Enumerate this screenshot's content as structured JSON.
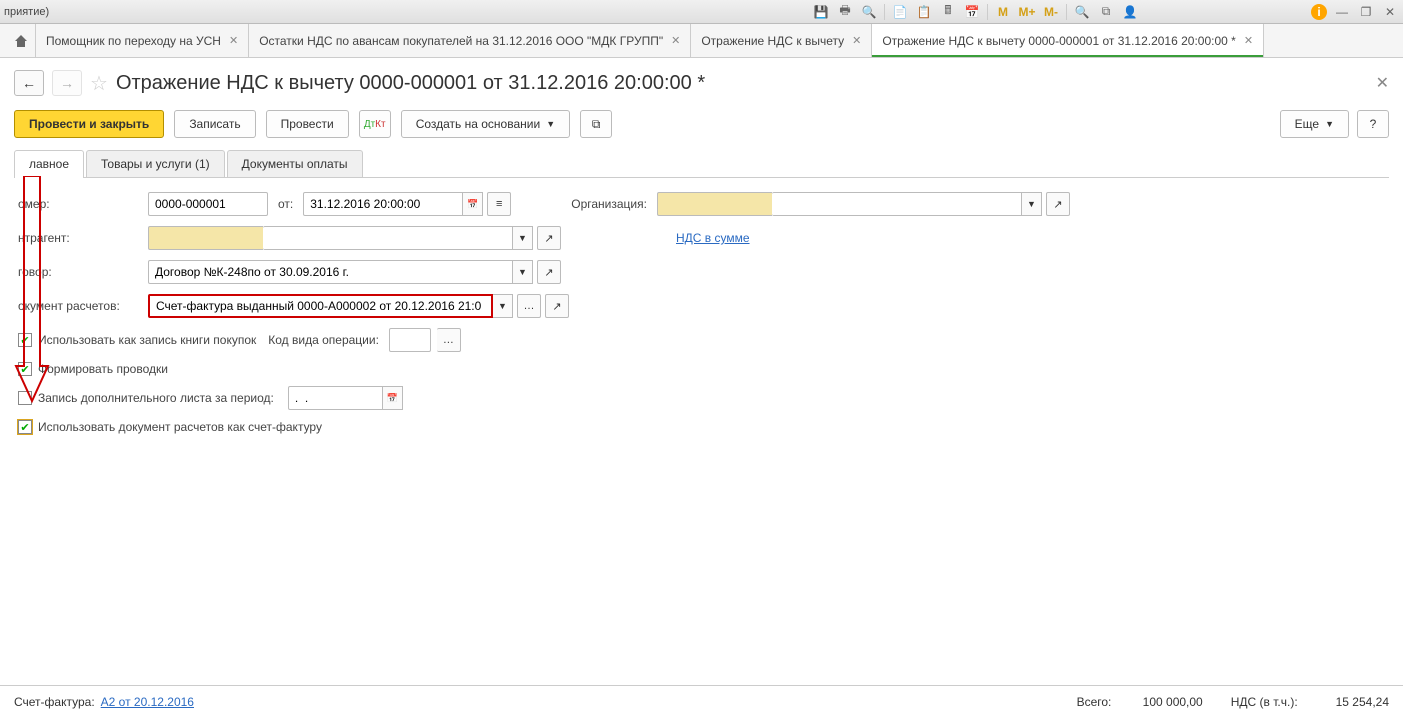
{
  "titlebar": {
    "left": "приятие)"
  },
  "tabs": [
    {
      "label": "Помощник по переходу на УСН"
    },
    {
      "label": "Остатки НДС по авансам покупателей на 31.12.2016 ООО \"МДК ГРУПП\""
    },
    {
      "label": "Отражение НДС к вычету"
    },
    {
      "label": "Отражение НДС к вычету 0000-000001 от 31.12.2016 20:00:00 *"
    }
  ],
  "page": {
    "title": "Отражение НДС к вычету 0000-000001 от 31.12.2016 20:00:00 *"
  },
  "toolbar": {
    "primary": "Провести и закрыть",
    "save": "Записать",
    "post": "Провести",
    "dtkt": "Дт/Кт",
    "create_based": "Создать на основании",
    "more": "Еще",
    "help": "?"
  },
  "form_tabs": {
    "main": "лавное",
    "goods": "Товары и услуги (1)",
    "docs": "Документы оплаты"
  },
  "form": {
    "number_label": "омер:",
    "number_value": "0000-000001",
    "date_label": "от:",
    "date_value": "31.12.2016 20:00:00",
    "org_label": "Организация:",
    "org_value": "",
    "vat_link": "НДС в сумме",
    "contragent_label": "нтрагент:",
    "contragent_value": "",
    "contract_label": "говор:",
    "contract_value": "Договор №К-248по от 30.09.2016 г.",
    "settlement_label": "окумент расчетов:",
    "settlement_value": "Счет-фактура выданный 0000-А000002 от 20.12.2016 21:0",
    "chk_book": "Использовать как запись книги покупок",
    "op_code_label": "Код вида операции:",
    "op_code_value": "",
    "chk_post": "Формировать проводки",
    "chk_addsheet": "Запись дополнительного листа за период:",
    "addsheet_date": ".  .",
    "chk_usesettle": "Использовать документ расчетов как счет-фактуру"
  },
  "footer": {
    "invoice_label": "Счет-фактура:",
    "invoice_link": "А2 от 20.12.2016",
    "total_label": "Всего:",
    "total_value": "100 000,00",
    "vat_label": "НДС (в т.ч.):",
    "vat_value": "15 254,24"
  }
}
